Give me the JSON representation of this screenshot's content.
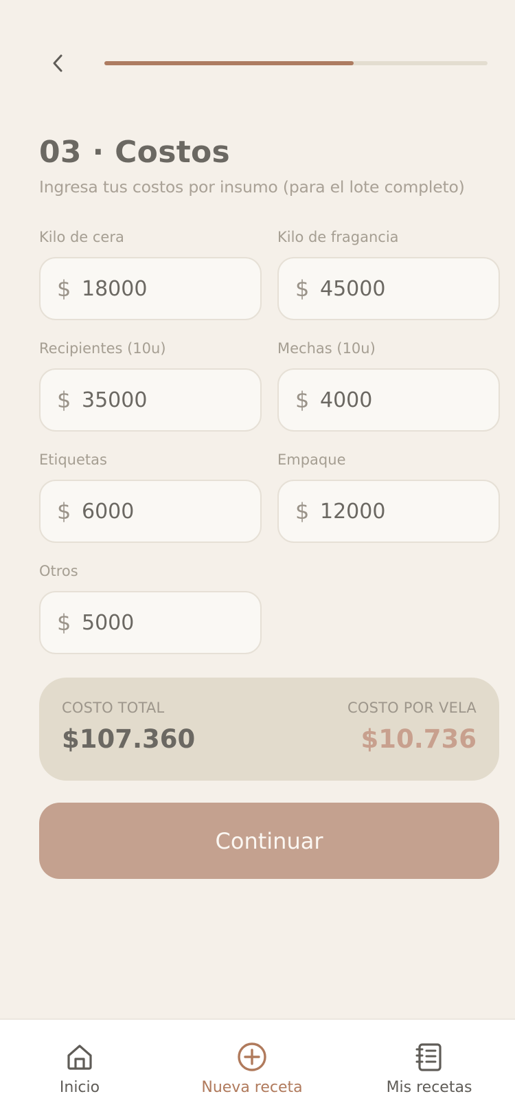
{
  "header": {
    "back_icon": "chevron-left-icon",
    "progress": 0.65
  },
  "title": "03 · Costos",
  "subtitle": "Ingresa tus costos por insumo (para el lote completo)",
  "currency_symbol": "$",
  "fields": [
    {
      "label": "Kilo de cera",
      "value": "18000"
    },
    {
      "label": "Kilo de fragancia",
      "value": "45000"
    },
    {
      "label": "Recipientes (10u)",
      "value": "35000"
    },
    {
      "label": "Mechas (10u)",
      "value": "4000"
    },
    {
      "label": "Etiquetas",
      "value": "6000"
    },
    {
      "label": "Empaque",
      "value": "12000"
    },
    {
      "label": "Otros",
      "value": "5000"
    }
  ],
  "summary": {
    "total_label": "COSTO TOTAL",
    "total_value": "$107.360",
    "per_unit_label": "COSTO POR VELA",
    "per_unit_value": "$10.736"
  },
  "continue_label": "Continuar",
  "tabs": [
    {
      "label": "Inicio",
      "icon": "home-icon",
      "active": false
    },
    {
      "label": "Nueva receta",
      "icon": "plus-circle-icon",
      "active": true
    },
    {
      "label": "Mis recetas",
      "icon": "notebook-icon",
      "active": false
    }
  ],
  "colors": {
    "background": "#f5f0e9",
    "accent": "#ad7c61",
    "text_primary": "#6b6862",
    "per_unit_value": "#c8a08e",
    "button": "#c4a18f",
    "tab_active": "#b07a5c",
    "tab_inactive": "#5f5c57"
  }
}
